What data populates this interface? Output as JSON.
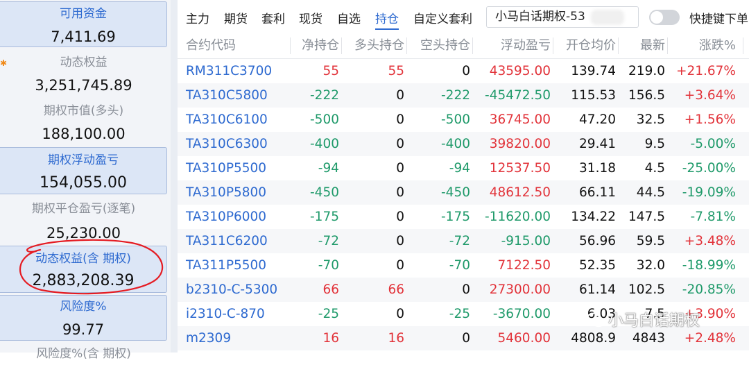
{
  "left_panel": {
    "cards": [
      {
        "label": "可用资金",
        "value": "7,411.69",
        "highlight": true
      },
      {
        "label": "动态权益",
        "value": "3,251,745.89",
        "highlight": false
      },
      {
        "label": "期权市值(多头)",
        "value": "188,100.00",
        "highlight": false
      },
      {
        "label": "期权浮动盈亏",
        "value": "154,055.00",
        "highlight": true
      },
      {
        "label": "期权平仓盈亏(逐笔)",
        "value": "25,230.00",
        "highlight": false
      },
      {
        "label": "动态权益(含 期权)",
        "value": "2,883,208.39",
        "highlight": true
      },
      {
        "label": "风险度%",
        "value": "99.77",
        "highlight": true
      },
      {
        "label": "风险度%(含 期权)",
        "value": "",
        "highlight": false
      }
    ]
  },
  "tabs": [
    "主力",
    "期货",
    "套利",
    "现货",
    "自选",
    "持仓",
    "自定义套利"
  ],
  "active_tab": "持仓",
  "account_name": "小马白话期权-53",
  "hotkey_label": "快捷键下单",
  "table": {
    "headers": [
      "合约代码",
      "净持仓",
      "多头持仓",
      "空头持仓",
      "浮动盈亏",
      "开仓均价",
      "最新",
      "涨跌%"
    ],
    "rows": [
      {
        "code": "RM311C3700",
        "net": "55",
        "long": "55",
        "short": "0",
        "pnl": "43595.00",
        "avg": "139.74",
        "last": "219.0",
        "chg": "+21.67%"
      },
      {
        "code": "TA310C5800",
        "net": "-222",
        "long": "0",
        "short": "-222",
        "pnl": "-45472.50",
        "avg": "115.53",
        "last": "156.5",
        "chg": "+3.64%"
      },
      {
        "code": "TA310C6100",
        "net": "-500",
        "long": "0",
        "short": "-500",
        "pnl": "36745.00",
        "avg": "47.20",
        "last": "32.5",
        "chg": "+1.56%"
      },
      {
        "code": "TA310C6300",
        "net": "-400",
        "long": "0",
        "short": "-400",
        "pnl": "39820.00",
        "avg": "29.41",
        "last": "9.5",
        "chg": "-5.00%"
      },
      {
        "code": "TA310P5500",
        "net": "-94",
        "long": "0",
        "short": "-94",
        "pnl": "12537.50",
        "avg": "31.18",
        "last": "4.5",
        "chg": "-25.00%"
      },
      {
        "code": "TA310P5800",
        "net": "-450",
        "long": "0",
        "short": "-450",
        "pnl": "48612.50",
        "avg": "66.11",
        "last": "44.5",
        "chg": "-19.09%"
      },
      {
        "code": "TA310P6000",
        "net": "-175",
        "long": "0",
        "short": "-175",
        "pnl": "-11620.00",
        "avg": "134.22",
        "last": "147.5",
        "chg": "-7.81%"
      },
      {
        "code": "TA311C6200",
        "net": "-72",
        "long": "0",
        "short": "-72",
        "pnl": "-915.00",
        "avg": "56.96",
        "last": "59.5",
        "chg": "+3.48%"
      },
      {
        "code": "TA311P5500",
        "net": "-70",
        "long": "0",
        "short": "-70",
        "pnl": "7122.50",
        "avg": "52.35",
        "last": "32.0",
        "chg": "-18.99%"
      },
      {
        "code": "b2310-C-5300",
        "net": "66",
        "long": "66",
        "short": "0",
        "pnl": "27300.00",
        "avg": "61.14",
        "last": "102.5",
        "chg": "-20.85%"
      },
      {
        "code": "i2310-C-870",
        "net": "-25",
        "long": "0",
        "short": "-25",
        "pnl": "-3670.00",
        "avg": "6.03",
        "last": "7.5",
        "chg": "+3.90%"
      },
      {
        "code": "m2309",
        "net": "16",
        "long": "16",
        "short": "0",
        "pnl": "5460.00",
        "avg": "4808.9",
        "last": "4843",
        "chg": "+2.48%"
      }
    ]
  },
  "watermark": "小马白话期权",
  "colors": {
    "accent": "#2e6ad0",
    "up": "#e2333a",
    "down": "#1f9a6a",
    "circle": "#e51c23"
  }
}
